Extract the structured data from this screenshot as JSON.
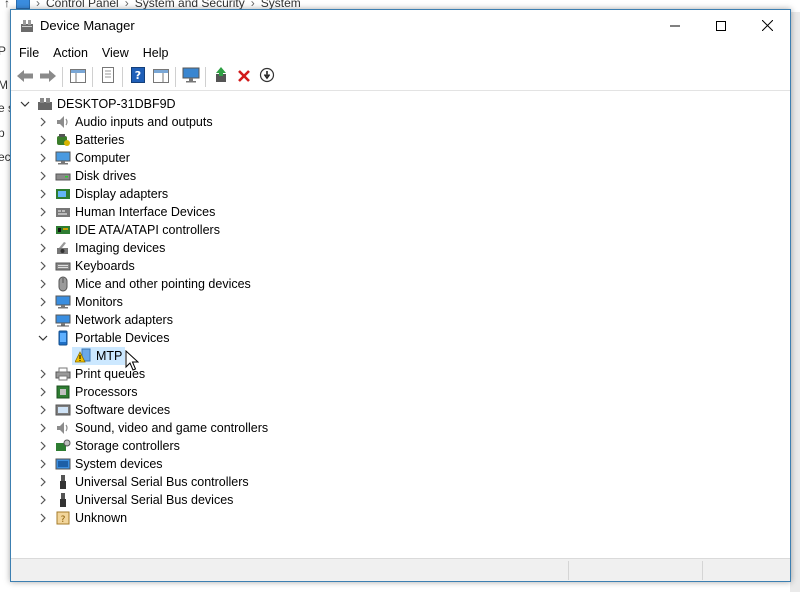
{
  "background": {
    "breadcrumbs": [
      "Control Panel",
      "System and Security",
      "System"
    ],
    "left_fragments": [
      "P",
      "M",
      "e s",
      "p",
      "ec"
    ]
  },
  "window": {
    "title": "Device Manager",
    "controls": {
      "minimize": "minimize-icon",
      "maximize": "maximize-icon",
      "close": "close-icon"
    }
  },
  "menu": [
    "File",
    "Action",
    "View",
    "Help"
  ],
  "toolbar": [
    "back-arrow-icon",
    "forward-arrow-icon",
    "show-hide-console-tree-icon",
    "properties-icon",
    "help-icon",
    "action-pane-icon",
    "scan-hardware-icon",
    "update-driver-icon",
    "uninstall-device-icon",
    "disable-device-icon"
  ],
  "tree": {
    "root": "DESKTOP-31DBF9D",
    "categories": [
      {
        "label": "Audio inputs and outputs",
        "icon": "speaker-icon"
      },
      {
        "label": "Batteries",
        "icon": "battery-icon"
      },
      {
        "label": "Computer",
        "icon": "computer-icon"
      },
      {
        "label": "Disk drives",
        "icon": "disk-drive-icon"
      },
      {
        "label": "Display adapters",
        "icon": "display-adapter-icon"
      },
      {
        "label": "Human Interface Devices",
        "icon": "hid-icon"
      },
      {
        "label": "IDE ATA/ATAPI controllers",
        "icon": "ide-controller-icon"
      },
      {
        "label": "Imaging devices",
        "icon": "camera-icon"
      },
      {
        "label": "Keyboards",
        "icon": "keyboard-icon"
      },
      {
        "label": "Mice and other pointing devices",
        "icon": "mouse-icon"
      },
      {
        "label": "Monitors",
        "icon": "monitor-icon"
      },
      {
        "label": "Network adapters",
        "icon": "network-adapter-icon"
      },
      {
        "label": "Portable Devices",
        "icon": "portable-device-icon",
        "expanded": true,
        "children": [
          {
            "label": "MTP",
            "icon": "warning-device-icon",
            "selected": true
          }
        ]
      },
      {
        "label": "Print queues",
        "icon": "printer-icon"
      },
      {
        "label": "Processors",
        "icon": "processor-icon"
      },
      {
        "label": "Software devices",
        "icon": "software-device-icon"
      },
      {
        "label": "Sound, video and game controllers",
        "icon": "sound-controller-icon"
      },
      {
        "label": "Storage controllers",
        "icon": "storage-controller-icon"
      },
      {
        "label": "System devices",
        "icon": "system-device-icon"
      },
      {
        "label": "Universal Serial Bus controllers",
        "icon": "usb-icon"
      },
      {
        "label": "Universal Serial Bus devices",
        "icon": "usb-device-icon"
      },
      {
        "label": "Unknown",
        "icon": "unknown-device-icon"
      }
    ]
  },
  "colors": {
    "selection": "#cce8ff",
    "window_border": "#3c7fb1",
    "warning": "#f2c200"
  }
}
